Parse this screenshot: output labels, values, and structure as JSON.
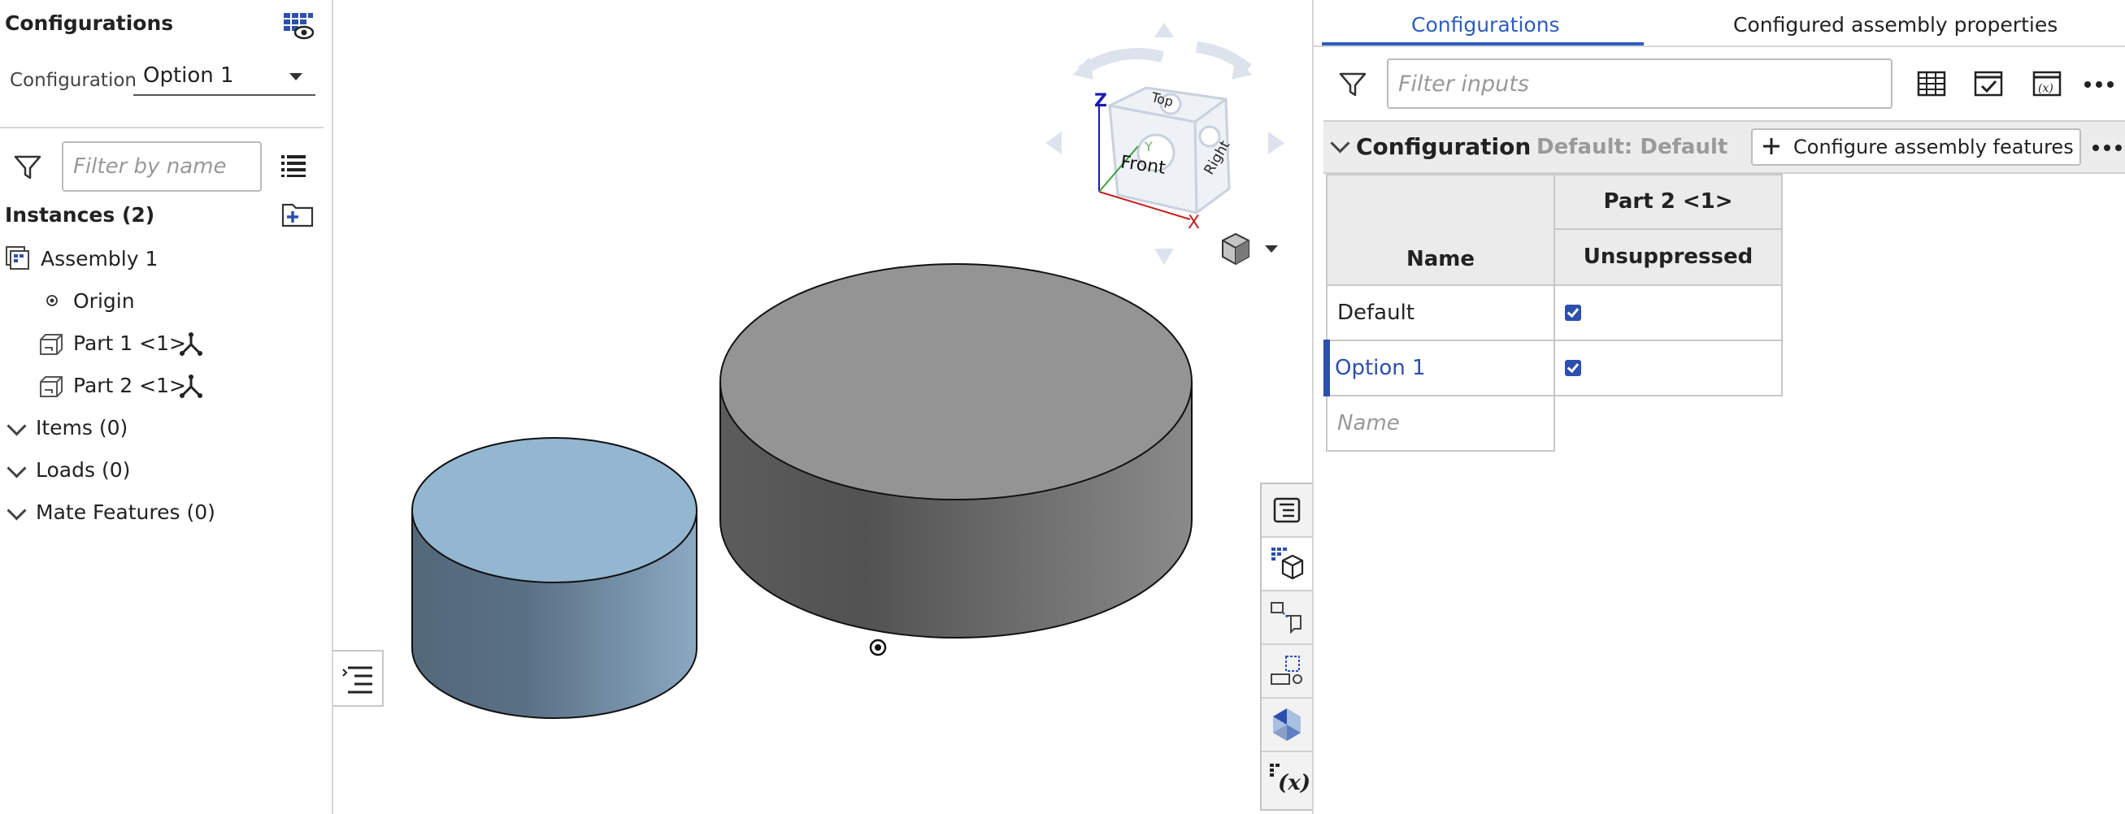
{
  "left_panel": {
    "title": "Configurations",
    "configuration_label": "Configuration",
    "configuration_value": "Option 1",
    "filter_placeholder": "Filter by name",
    "instances_header": "Instances (2)",
    "tree": {
      "assembly": "Assembly 1",
      "origin": "Origin",
      "part1": "Part 1 <1>",
      "part2": "Part 2 <1>"
    },
    "sections": {
      "items": "Items (0)",
      "loads": "Loads (0)",
      "mate_features": "Mate Features (0)"
    }
  },
  "view_cube": {
    "faces": {
      "top": "Top",
      "front": "Front",
      "right": "Right"
    },
    "axes": {
      "x": "X",
      "y": "Y",
      "z": "Z"
    }
  },
  "right_panel": {
    "tabs": [
      "Configurations",
      "Configured assembly properties"
    ],
    "active_tab": "Configurations",
    "filter_placeholder": "Filter inputs",
    "config_title": "Configuration",
    "config_default": "Default: Default",
    "configure_button": "Configure assembly features",
    "table": {
      "group_header": "Part 2 <1>",
      "col_name": "Name",
      "col_state": "Unsuppressed",
      "rows": [
        {
          "name": "Default",
          "checked": true
        },
        {
          "name": "Option 1",
          "checked": true
        }
      ],
      "new_row_placeholder": "Name"
    }
  },
  "colors": {
    "accent": "#2d5dbf",
    "part_blue": "#8fb4d0",
    "part_gray": "#8e8e8e"
  },
  "icons": [
    "configurations-table-icon",
    "filter-icon",
    "list-icon",
    "new-folder-icon",
    "assembly-icon",
    "origin-icon",
    "part-icon",
    "mate-connector-icon",
    "chevron-down-icon",
    "view-cube-icon",
    "table-icon",
    "checklist-icon",
    "variable-icon",
    "more-icon",
    "plus-icon"
  ]
}
